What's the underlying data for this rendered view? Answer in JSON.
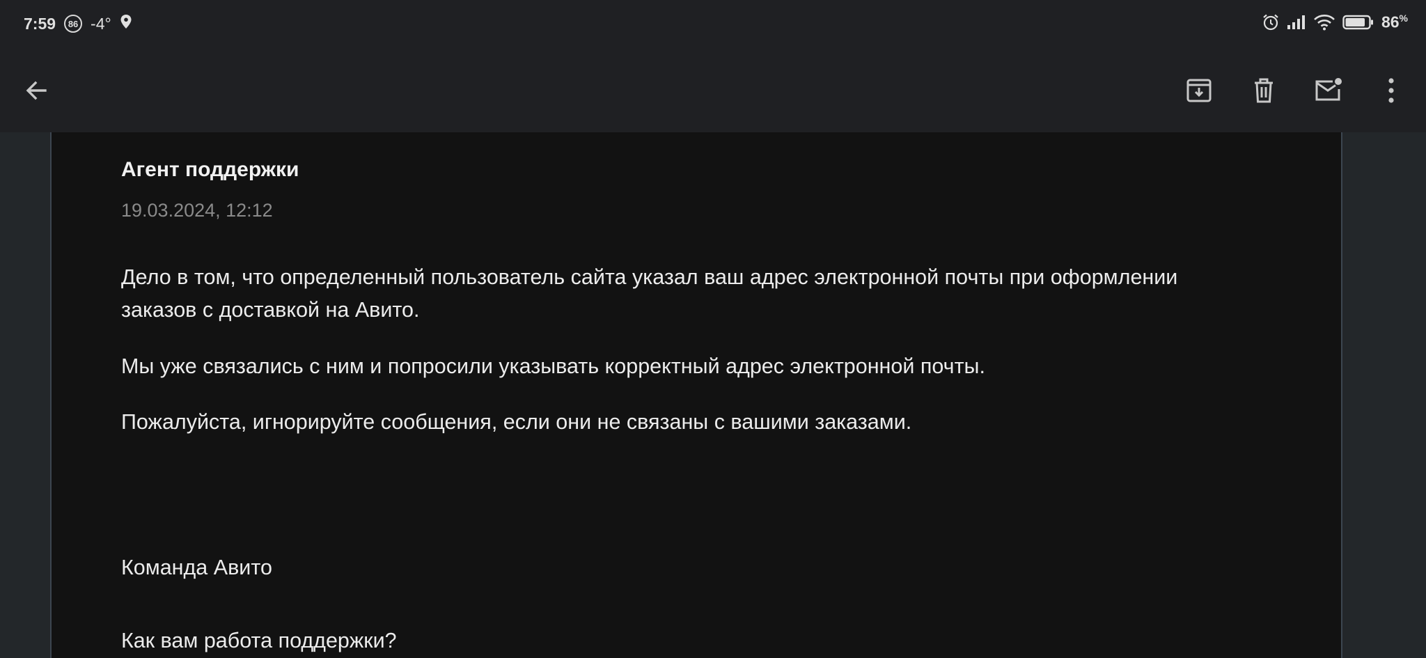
{
  "status_bar": {
    "time": "7:59",
    "badge": "86",
    "temperature": "-4°",
    "battery_percent": "86",
    "battery_unit": "%",
    "battery_level": 0.86
  },
  "app_bar": {
    "back_icon": "arrow-back-icon",
    "actions": [
      "archive-icon",
      "delete-icon",
      "mark-unread-icon",
      "more-vert-icon"
    ]
  },
  "message": {
    "sender": "Агент поддержки",
    "date": "19.03.2024, 12:12",
    "paragraphs": [
      "Дело в том, что определенный пользователь сайта указал ваш адрес электронной почты при оформлении заказов с доставкой на Авито.",
      "Мы уже связались с ним и попросили указывать корректный адрес электронной почты.",
      "Пожалуйста, игнорируйте сообщения, если они не связаны с вашими заказами."
    ],
    "signature": "Команда Авито",
    "question": "Как вам работа поддержки?"
  },
  "colors": {
    "bar_bg": "#1f2023",
    "card_bg": "#121212",
    "outer_bg": "#23272a",
    "text": "#ececec",
    "muted": "#8a8a8a"
  }
}
